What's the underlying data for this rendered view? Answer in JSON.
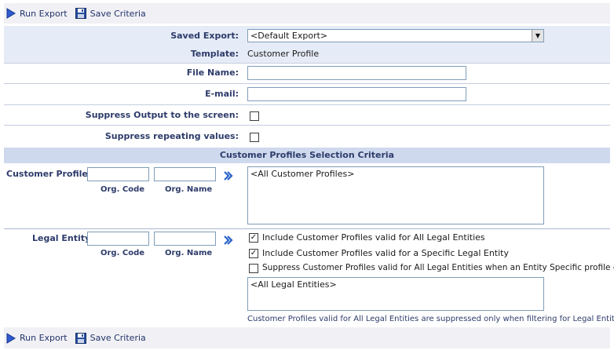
{
  "toolbar": {
    "run_export": "Run Export",
    "save_criteria": "Save Criteria"
  },
  "form": {
    "saved_export_label": "Saved Export:",
    "saved_export_value": "<Default Export>",
    "template_label": "Template:",
    "template_value": "Customer Profile",
    "file_name_label": "File Name:",
    "file_name_value": "",
    "email_label": "E-mail:",
    "email_value": "",
    "suppress_output_label": "Suppress Output to the screen:",
    "suppress_repeating_label": "Suppress repeating values:"
  },
  "criteria": {
    "section_title": "Customer Profiles Selection Criteria",
    "customer_profile": {
      "label": "Customer Profile:",
      "org_code_label": "Org. Code",
      "org_name_label": "Org. Name",
      "list_items": [
        "<All Customer Profiles>"
      ]
    },
    "legal_entity": {
      "label": "Legal Entity:",
      "org_code_label": "Org. Code",
      "org_name_label": "Org. Name",
      "options": [
        {
          "label": "Include Customer Profiles valid for All Legal Entities",
          "checked": true
        },
        {
          "label": "Include Customer Profiles valid for a Specific Legal Entity",
          "checked": true
        },
        {
          "label": "Suppress Customer Profiles valid for All Legal Entities when an Entity Specific profile exists",
          "checked": false
        }
      ],
      "list_items": [
        "<All Legal Entities>"
      ],
      "note": "Customer Profiles valid for All Legal Entities are suppressed only when filtering for Legal Entities"
    }
  },
  "colors": {
    "label_text": "#2d3b6a",
    "shade": "#e6ecf7",
    "section_bg": "#cfd9ee",
    "toolbar_bg": "#f1f1f5"
  }
}
